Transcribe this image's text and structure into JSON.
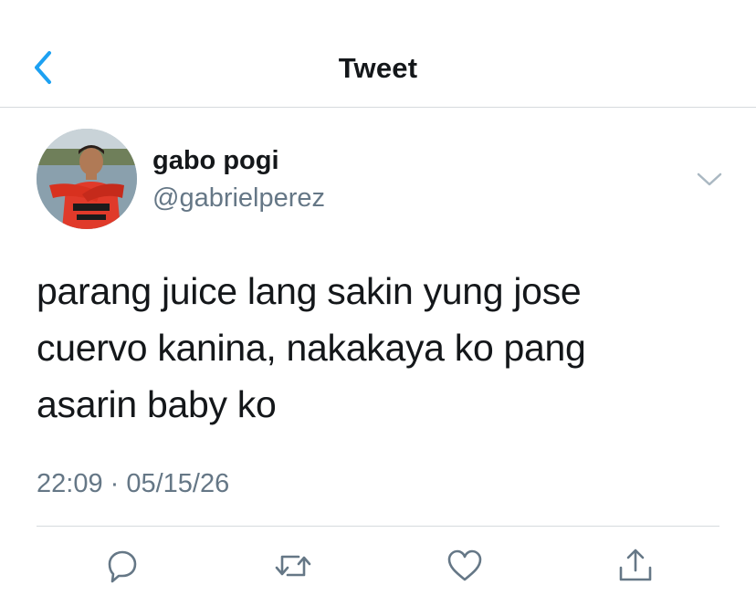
{
  "header": {
    "title": "Tweet",
    "back_icon": "chevron-left-icon"
  },
  "author": {
    "display_name": "gabo pogi",
    "handle": "@gabrielperez"
  },
  "tweet": {
    "text_lines": [
      "parang juice lang sakin yung jose",
      "cuervo kanina, nakakaya ko pang",
      "asarin baby ko"
    ],
    "timestamp": "22:09 · 05/15/26"
  },
  "actions": {
    "reply_icon": "reply-bubble-icon",
    "retweet_icon": "retweet-icon",
    "like_icon": "heart-icon",
    "share_icon": "share-icon"
  },
  "colors": {
    "accent": "#1da1f2",
    "text": "#14171a",
    "secondary": "#657786",
    "divider": "#d6dadd"
  }
}
